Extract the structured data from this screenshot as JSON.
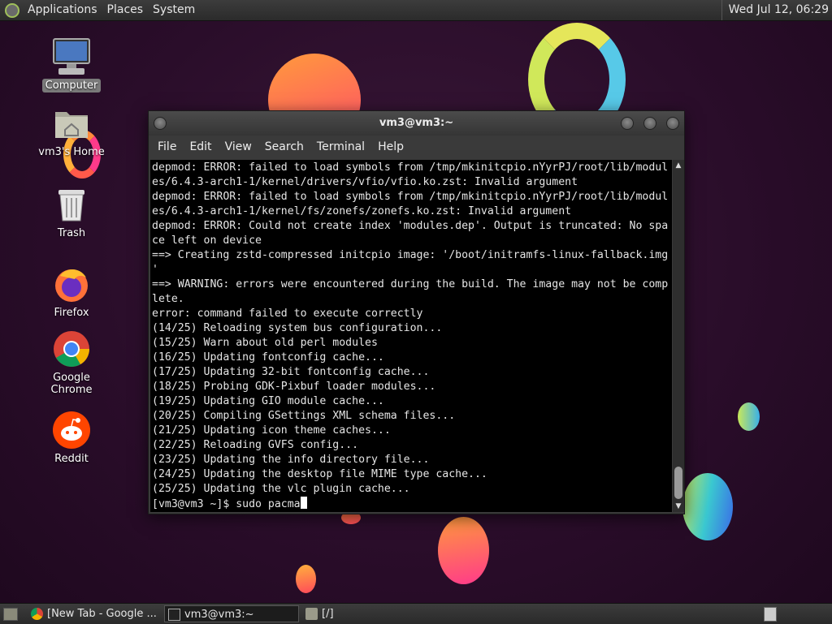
{
  "top_panel": {
    "menus": [
      "Applications",
      "Places",
      "System"
    ],
    "clock": "Wed Jul 12, 06:29"
  },
  "desktop_icons": [
    {
      "label": "Computer",
      "icon": "computer-icon"
    },
    {
      "label": "vm3's Home",
      "icon": "home-folder-icon"
    },
    {
      "label": "Trash",
      "icon": "trash-icon"
    },
    {
      "label": "Firefox",
      "icon": "firefox-icon"
    },
    {
      "label": "Google Chrome",
      "icon": "chrome-icon"
    },
    {
      "label": "Reddit",
      "icon": "reddit-icon"
    }
  ],
  "terminal": {
    "title": "vm3@vm3:~",
    "menu": [
      "File",
      "Edit",
      "View",
      "Search",
      "Terminal",
      "Help"
    ],
    "lines": [
      "depmod: ERROR: failed to load symbols from /tmp/mkinitcpio.nYyrPJ/root/lib/modul",
      "es/6.4.3-arch1-1/kernel/drivers/vfio/vfio.ko.zst: Invalid argument",
      "depmod: ERROR: failed to load symbols from /tmp/mkinitcpio.nYyrPJ/root/lib/modul",
      "es/6.4.3-arch1-1/kernel/fs/zonefs/zonefs.ko.zst: Invalid argument",
      "depmod: ERROR: Could not create index 'modules.dep'. Output is truncated: No spa",
      "ce left on device",
      "==> Creating zstd-compressed initcpio image: '/boot/initramfs-linux-fallback.img",
      "'",
      "==> WARNING: errors were encountered during the build. The image may not be comp",
      "lete.",
      "error: command failed to execute correctly",
      "(14/25) Reloading system bus configuration...",
      "(15/25) Warn about old perl modules",
      "(16/25) Updating fontconfig cache...",
      "(17/25) Updating 32-bit fontconfig cache...",
      "(18/25) Probing GDK-Pixbuf loader modules...",
      "(19/25) Updating GIO module cache...",
      "(20/25) Compiling GSettings XML schema files...",
      "(21/25) Updating icon theme caches...",
      "(22/25) Reloading GVFS config...",
      "(23/25) Updating the info directory file...",
      "(24/25) Updating the desktop file MIME type cache...",
      "(25/25) Updating the vlc plugin cache..."
    ],
    "prompt": "[vm3@vm3 ~]$ sudo pacma"
  },
  "taskbar": {
    "tasks": [
      {
        "label": "[New Tab - Google ...",
        "icon": "chrome-icon"
      },
      {
        "label": "vm3@vm3:~",
        "icon": "terminal-icon"
      },
      {
        "label": "[/]",
        "icon": "folder-icon"
      }
    ]
  }
}
